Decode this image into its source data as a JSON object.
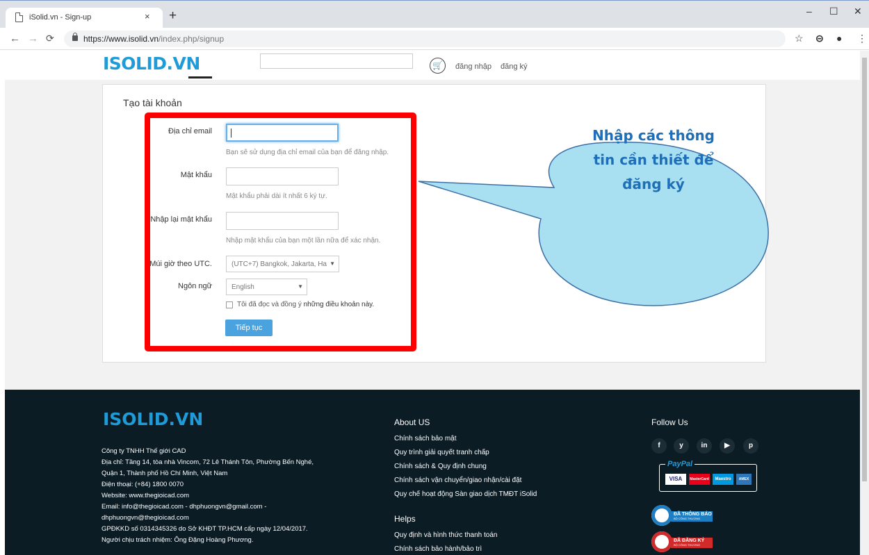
{
  "browser": {
    "tab_title": "iSolid.vn - Sign-up",
    "tab_close": "×",
    "new_tab": "+",
    "url_prefix": "https://www.isolid.vn",
    "url_path": "/index.php/signup",
    "win_min": "–",
    "win_max": "☐",
    "win_close": "✕"
  },
  "header": {
    "logo": "ISOLID.VN",
    "login": "đăng nhập",
    "signup": "đăng ký",
    "search_value": ""
  },
  "form": {
    "title": "Tạo tài khoản",
    "email_label": "Địa chỉ email",
    "email_help": "Bạn sẽ sử dụng địa chỉ email của bạn để đăng nhập.",
    "password_label": "Mật khẩu",
    "password_help": "Mật khẩu phải dài ít nhất 6 ký tự.",
    "confirm_label": "Nhập lại mật khẩu",
    "confirm_help": "Nhập mật khẩu của bạn một lần nữa để xác nhận.",
    "timezone_label": "Múi giờ theo UTC.",
    "timezone_value": "(UTC+7) Bangkok, Jakarta, Ha",
    "language_label": "Ngôn ngữ",
    "language_value": "English",
    "agree_text": "Tôi đã đọc và đồng ý",
    "agree_link": "những điều khoản này.",
    "submit": "Tiếp tục"
  },
  "callout": {
    "line1": "Nhập các thông",
    "line2": "tin cần thiết để",
    "line3": "đăng ký"
  },
  "footer": {
    "logo": "ISOLID.VN",
    "company": [
      "Công ty TNHH Thế giới CAD",
      "Địa chỉ: Tầng 14, tòa nhà Vincom, 72 Lê Thánh Tôn, Phường Bến Nghé,",
      "Quận 1, Thành phố Hồ Chí Minh, Việt Nam",
      "Điện thoại: (+84) 1800 0070",
      "Website: www.thegioicad.com",
      "Email: info@thegioicad.com - dhphuongvn@gmail.com -",
      "dhphuongvn@thegioicad.com",
      "GPĐKKD số 0314345326 do Sở KHĐT TP.HCM cấp ngày 12/04/2017.",
      "Người chịu trách nhiệm: Ông Đặng Hoàng Phương."
    ],
    "about_title": "About US",
    "about_links": [
      "Chính sách bảo mật",
      "Quy trình giải quyết tranh chấp",
      "Chính sách & Quy định chung",
      "Chính sách vận chuyển/giao nhận/cài đặt",
      "Quy chế hoạt động Sàn giao dịch TMĐT iSolid"
    ],
    "helps_title": "Helps",
    "helps_links": [
      "Quy định và hình thức thanh toán",
      "Chính sách bảo hành/bảo trì"
    ],
    "follow_title": "Follow Us",
    "social": [
      "f",
      "y",
      "in",
      "▶",
      "p"
    ],
    "paypal_label": "PayPal",
    "cards": [
      "VISA",
      "MasterCard",
      "Maestro",
      "AMEX"
    ],
    "badge1": "ĐÃ THÔNG BÁO",
    "badge2": "ĐÃ ĐĂNG KÝ",
    "badge_sub": "BỘ CÔNG THƯƠNG"
  },
  "colors": {
    "brand": "#1f9bd7",
    "highlight_box": "#ff0000",
    "button": "#4aa3df",
    "footer_bg": "#0b1c24",
    "callout_fill": "#a8e0f2"
  }
}
